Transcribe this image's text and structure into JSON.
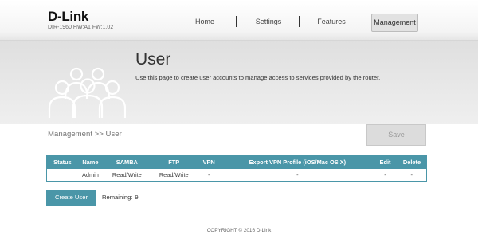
{
  "header": {
    "logo": "D-Link",
    "model": "DIR-1960 HW:A1 FW:1.02",
    "nav": [
      "Home",
      "Settings",
      "Features",
      "Management"
    ],
    "active_nav": "Management"
  },
  "hero": {
    "icon": "users-group-icon",
    "title": "User",
    "description": "Use this page to create user accounts to manage access to services provided by the router."
  },
  "breadcrumb": "Management >> User",
  "toolbar": {
    "save_label": "Save"
  },
  "user_table": {
    "columns": [
      "Status",
      "Name",
      "SAMBA",
      "FTP",
      "VPN",
      "Export VPN Profile (iOS/Mac OS X)",
      "Edit",
      "Delete"
    ],
    "rows": [
      {
        "status": "",
        "name": "Admin",
        "samba": "Read/Write",
        "ftp": "Read/Write",
        "vpn": "-",
        "export": "-",
        "edit": "-",
        "delete": "-"
      }
    ]
  },
  "create_user": {
    "button_label": "Create User",
    "remaining_label": "Remaining:",
    "remaining_count": "9"
  },
  "footer": {
    "copyright": "COPYRIGHT © 2016 D-Link"
  },
  "colors": {
    "accent": "#4a96a8",
    "save_disabled": "#dcdcdc",
    "hero_bg": "#e6e6e6"
  }
}
